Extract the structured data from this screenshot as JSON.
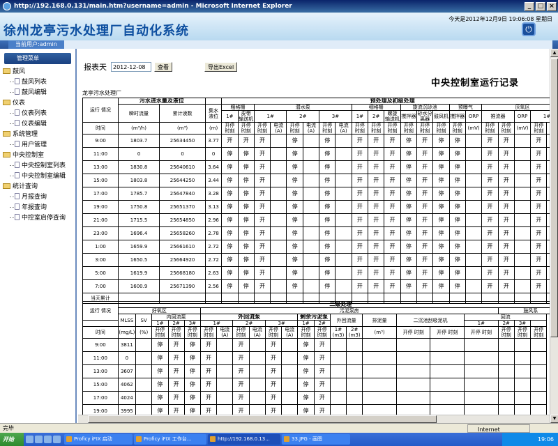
{
  "window": {
    "title": "http://192.168.0.131/main.htm?username=admin - Microsoft Internet Explorer"
  },
  "header": {
    "title": "徐州龙亭污水处理厂自动化系统",
    "datetime": "今天是2012年12月9日 19:06:08 星期日"
  },
  "userbar": {
    "current_user": "当前用户:admin"
  },
  "sidebar": {
    "head": "管理菜单",
    "groups": [
      {
        "label": "鼓风",
        "items": [
          "鼓风列表",
          "鼓风编辑"
        ]
      },
      {
        "label": "仪表",
        "items": [
          "仪表列表",
          "仪表编辑"
        ]
      },
      {
        "label": "系统管理",
        "items": [
          "用户管理"
        ]
      },
      {
        "label": "中央控制室",
        "items": [
          "中央控制室列表",
          "中央控制室编辑"
        ]
      },
      {
        "label": "统计查询",
        "items": [
          "月报查询",
          "年报查询",
          "中控室启停查询"
        ]
      }
    ]
  },
  "toolbar": {
    "label": "报表天",
    "date_value": "2012-12-08",
    "query_btn": "查看",
    "export_btn": "导出Excel"
  },
  "report": {
    "title": "中央控制室运行记录",
    "plant": "龙亭污水处理厂"
  },
  "table1": {
    "h_run": "运行\n情况",
    "h_time": "时间",
    "h_inflow": "污水进水量及液位",
    "h_pre": "预处理及初级处理",
    "h_flow_inst": "瞬时流量",
    "h_flow_total": "累计读数",
    "h_level": "集水\n液位",
    "h_coarse": "粗格栅",
    "h_pump": "潜水泵",
    "h_fine": "细格栅",
    "h_grit": "旋流沉砂池",
    "h_pre_aer": "预曝气",
    "h_anaer": "厌氧区",
    "h_unit_flow": "(m³/h)",
    "h_unit_total": "(m³)",
    "h_unit_level": "(m)",
    "h_unit_mv": "(mV)",
    "h_no1": "1#",
    "h_no2": "2#",
    "h_no3": "3#",
    "h_convey": "皮带\n输送机",
    "h_screw": "螺旋\n输送机",
    "h_stir": "搅拌器",
    "h_sand": "砂水分\n离器",
    "h_fan": "鼓风机",
    "h_orp": "ORP",
    "h_mixer": "推流器",
    "h_onoff": "开停\n时刻",
    "h_current": "电流\n(A)",
    "total_label": "当天累计",
    "rows": [
      {
        "t": "9:00",
        "f": "1803.7",
        "s": "25634450",
        "l": "3.77",
        "c": [
          "开",
          "开",
          "开",
          "停",
          "停",
          "开",
          "开",
          "开",
          "停",
          "开",
          "停",
          "停",
          "开",
          "开",
          "开"
        ]
      },
      {
        "t": "11:00",
        "f": "0",
        "s": "0",
        "l": "0",
        "c": [
          "停",
          "停",
          "开",
          "停",
          "停",
          "开",
          "开",
          "开",
          "停",
          "开",
          "停",
          "停",
          "开",
          "开",
          "开"
        ]
      },
      {
        "t": "13:00",
        "f": "1830.8",
        "s": "25640610",
        "l": "3.64",
        "c": [
          "停",
          "停",
          "开",
          "停",
          "停",
          "开",
          "开",
          "开",
          "停",
          "开",
          "停",
          "停",
          "开",
          "开",
          "开"
        ]
      },
      {
        "t": "15:00",
        "f": "1803.8",
        "s": "25644250",
        "l": "3.44",
        "c": [
          "停",
          "停",
          "开",
          "停",
          "停",
          "开",
          "开",
          "开",
          "停",
          "开",
          "停",
          "停",
          "开",
          "开",
          "开"
        ]
      },
      {
        "t": "17:00",
        "f": "1785.7",
        "s": "25647840",
        "l": "3.28",
        "c": [
          "停",
          "停",
          "开",
          "停",
          "停",
          "开",
          "开",
          "开",
          "停",
          "开",
          "停",
          "停",
          "开",
          "开",
          "开"
        ]
      },
      {
        "t": "19:00",
        "f": "1750.8",
        "s": "25651370",
        "l": "3.13",
        "c": [
          "停",
          "停",
          "开",
          "停",
          "停",
          "开",
          "开",
          "开",
          "停",
          "开",
          "停",
          "停",
          "开",
          "开",
          "开"
        ]
      },
      {
        "t": "21:00",
        "f": "1715.5",
        "s": "25654850",
        "l": "2.96",
        "c": [
          "停",
          "停",
          "开",
          "停",
          "停",
          "开",
          "开",
          "开",
          "停",
          "开",
          "停",
          "停",
          "开",
          "开",
          "开"
        ]
      },
      {
        "t": "23:00",
        "f": "1696.4",
        "s": "25658260",
        "l": "2.78",
        "c": [
          "停",
          "停",
          "开",
          "停",
          "停",
          "开",
          "开",
          "开",
          "停",
          "开",
          "停",
          "停",
          "开",
          "开",
          "开"
        ]
      },
      {
        "t": "1:00",
        "f": "1659.9",
        "s": "25661610",
        "l": "2.72",
        "c": [
          "停",
          "停",
          "开",
          "停",
          "停",
          "开",
          "开",
          "开",
          "停",
          "开",
          "停",
          "停",
          "开",
          "开",
          "开"
        ]
      },
      {
        "t": "3:00",
        "f": "1650.5",
        "s": "25664920",
        "l": "2.72",
        "c": [
          "停",
          "停",
          "开",
          "停",
          "停",
          "开",
          "开",
          "开",
          "停",
          "开",
          "停",
          "停",
          "开",
          "开",
          "开"
        ]
      },
      {
        "t": "5:00",
        "f": "1619.9",
        "s": "25668180",
        "l": "2.63",
        "c": [
          "停",
          "停",
          "开",
          "停",
          "停",
          "开",
          "开",
          "开",
          "停",
          "开",
          "停",
          "停",
          "开",
          "开",
          "开"
        ]
      },
      {
        "t": "7:00",
        "f": "1600.9",
        "s": "25671390",
        "l": "2.56",
        "c": [
          "停",
          "停",
          "开",
          "停",
          "停",
          "开",
          "开",
          "开",
          "停",
          "开",
          "停",
          "停",
          "开",
          "开",
          "开"
        ]
      }
    ]
  },
  "table2": {
    "h_run": "运行\n情况",
    "h_time": "时间",
    "h_second": "二级处理",
    "h_aerobic": "好氧区",
    "h_sludge_pump": "污泥泵房",
    "h_blower": "鼓风系",
    "h_mlss": "MLSS",
    "h_sv": "SV",
    "h_mlss_unit": "(mg/L)",
    "h_sv_unit": "(%)",
    "h_inner": "内回流泵",
    "h_outer": "外回流泵",
    "h_waste": "剩余污泥泵",
    "h_outflow": "外回流量",
    "h_waste_flow": "排泥量",
    "h_scraper": "二沉池刮吸泥机",
    "h_return": "回流",
    "h_no1": "1#",
    "h_no2": "2#",
    "h_no3": "3#",
    "h_onoff": "开停\n时刻",
    "h_current": "电流\n(A)",
    "h_m3_1": "1#\n(m3)",
    "h_m3_2": "2#\n(m3)",
    "h_m3": "(m³)",
    "rows": [
      {
        "t": "9:00",
        "m": "3811",
        "c": [
          "停",
          "开",
          "停",
          "开",
          "开",
          "开",
          "停",
          "开"
        ]
      },
      {
        "t": "11:00",
        "m": "0",
        "c": [
          "停",
          "开",
          "停",
          "开",
          "开",
          "开",
          "停",
          "开"
        ]
      },
      {
        "t": "13:00",
        "m": "3607",
        "c": [
          "停",
          "开",
          "停",
          "开",
          "开",
          "开",
          "停",
          "开"
        ]
      },
      {
        "t": "15:00",
        "m": "4062",
        "c": [
          "停",
          "开",
          "停",
          "开",
          "开",
          "开",
          "停",
          "开"
        ]
      },
      {
        "t": "17:00",
        "m": "4024",
        "c": [
          "停",
          "开",
          "停",
          "开",
          "开",
          "开",
          "停",
          "开"
        ]
      },
      {
        "t": "19:00",
        "m": "3995",
        "c": [
          "停",
          "开",
          "停",
          "开",
          "开",
          "开",
          "停",
          "开"
        ]
      }
    ]
  },
  "status": {
    "left": "完毕",
    "zone": "Internet"
  },
  "taskbar": {
    "start": "开始",
    "tasks": [
      "Proficy iFIX 启动",
      "Proficy iFIX 工作台...",
      "http://192.168.0.13...",
      "33.JPG - 画图"
    ],
    "clock": "19:06"
  }
}
